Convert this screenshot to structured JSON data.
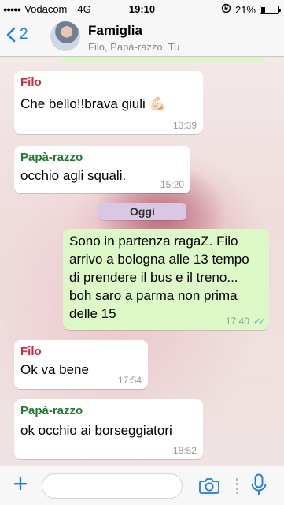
{
  "status": {
    "carrier": "Vodacom",
    "network": "4G",
    "time": "19:10",
    "battery": "21%"
  },
  "header": {
    "back_count": "2",
    "group_name": "Famiglia",
    "members": "Filo, Papà-razzo, Tu"
  },
  "day_divider": "Oggi",
  "messages": [
    {
      "sender": "Filo",
      "text": "Che bello!!brava giuli 💪🏻",
      "time": "13:39"
    },
    {
      "sender": "Papà-razzo",
      "text": "occhio agli squali.",
      "time": "15:20"
    },
    {
      "sender": "",
      "text": "Sono in partenza ragaZ. Filo arrivo a bologna alle 13 tempo di prendere il bus e il treno... boh saro a parma non prima delle 15",
      "time": "17:40"
    },
    {
      "sender": "Filo",
      "text": "Ok va bene",
      "time": "17:54"
    },
    {
      "sender": "Papà-razzo",
      "text": "ok occhio ai borseggiatori",
      "time": "18:52"
    }
  ],
  "input": {
    "placeholder": ""
  },
  "colors": {
    "accent": "#1a7bf2",
    "outgoing": "#dcf8c6",
    "filo": "#d3273b",
    "papa": "#1f7a2e",
    "ticks": "#4fb6ec"
  },
  "icons": [
    "back-chevron-icon",
    "plus-icon",
    "camera-icon",
    "microphone-icon",
    "read-receipt-icon"
  ]
}
